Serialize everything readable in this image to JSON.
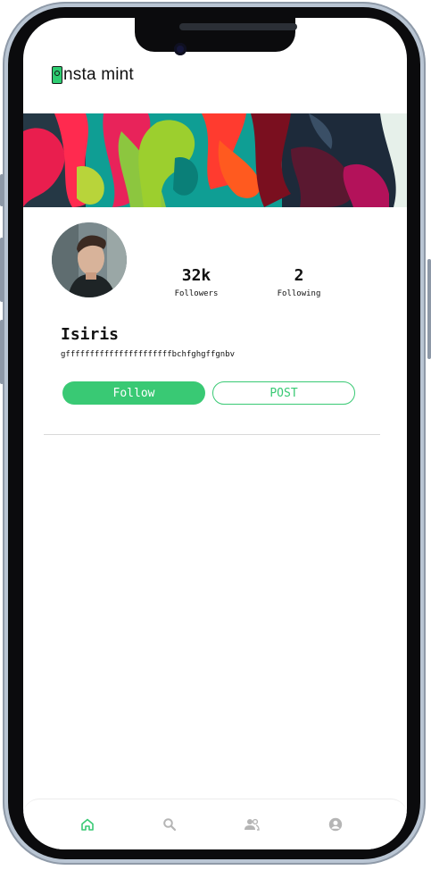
{
  "app": {
    "name": "nsta mint",
    "brand_color": "#39c974"
  },
  "profile": {
    "name": "Isiris",
    "bio": "gffffffffffffffffffffffbchfghgffgnbv",
    "stats": [
      {
        "value": "32k",
        "label": "Followers"
      },
      {
        "value": "2",
        "label": "Following"
      }
    ]
  },
  "actions": {
    "follow_label": "Follow",
    "post_label": "POST"
  },
  "bottom_nav": {
    "items": [
      {
        "icon": "home-icon",
        "active": true
      },
      {
        "icon": "search-icon",
        "active": false
      },
      {
        "icon": "people-icon",
        "active": false
      },
      {
        "icon": "profile-icon",
        "active": false
      }
    ]
  }
}
